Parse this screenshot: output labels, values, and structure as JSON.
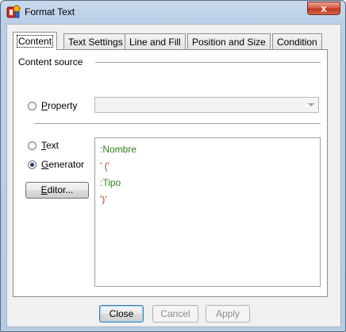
{
  "window": {
    "title": "Format Text",
    "close_glyph": "x"
  },
  "tabs": [
    "Content",
    "Text Settings",
    "Line and Fill",
    "Position and Size",
    "Condition"
  ],
  "content": {
    "group_label": "Content source",
    "property_radio": {
      "accel": "P",
      "rest": "roperty",
      "checked": false
    },
    "property_dropdown_value": "",
    "text_radio": {
      "accel": "T",
      "rest": "ext",
      "checked": false
    },
    "generator_radio": {
      "accel": "G",
      "rest": "enerator",
      "checked": true
    },
    "editor_button": {
      "accel": "E",
      "rest": "ditor..."
    },
    "generator_lines": [
      {
        "text": ":Nombre",
        "color": "green"
      },
      {
        "text": "'  ('",
        "color": "red"
      },
      {
        "text": ":Tipo",
        "color": "green"
      },
      {
        "text": "')'",
        "color": "red"
      }
    ]
  },
  "footer": {
    "close": "Close",
    "cancel": "Cancel",
    "apply": "Apply"
  },
  "colors": {
    "green_text": "#2f7f1c",
    "red_text": "#b33a18",
    "close_button": "#c2381f"
  }
}
